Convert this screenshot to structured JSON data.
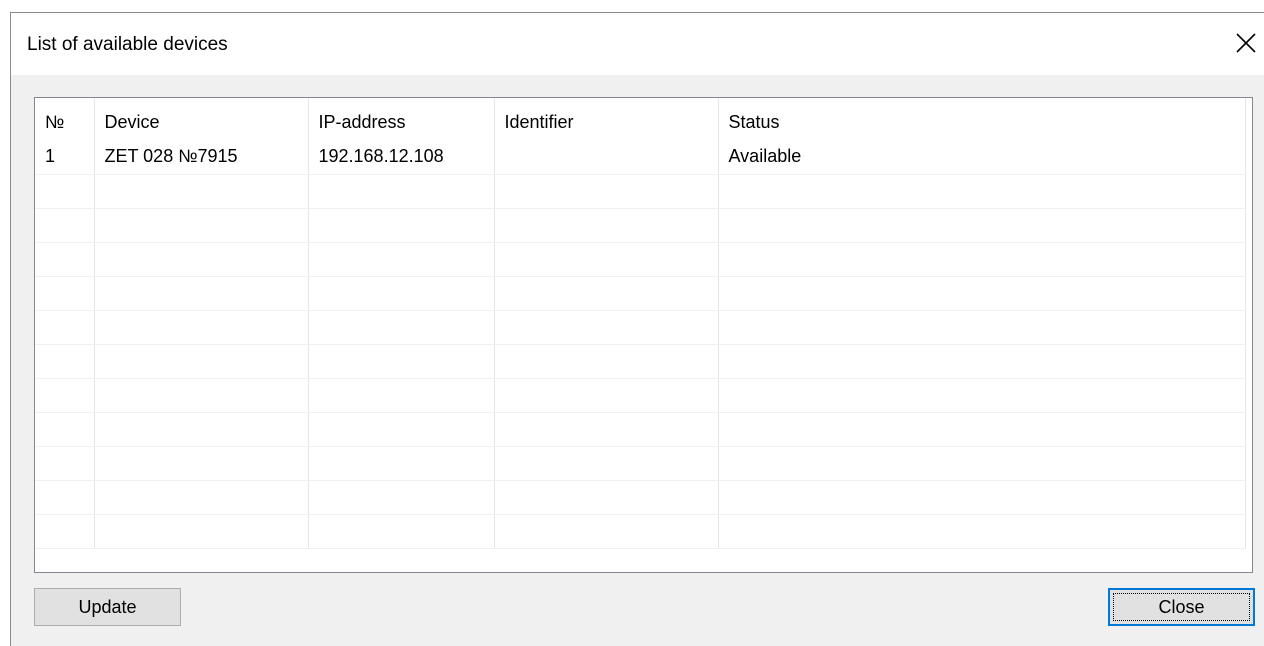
{
  "window": {
    "title": "List of available devices"
  },
  "table": {
    "columns": [
      "№",
      "Device",
      "IP-address",
      "Identifier",
      "Status"
    ],
    "rows": [
      [
        "1",
        "ZET 028 №7915",
        "192.168.12.108",
        "",
        "Available"
      ]
    ]
  },
  "buttons": {
    "update": "Update",
    "close": "Close"
  },
  "colors": {
    "window_bg": "#f0f0f0",
    "focus_accent": "#0078d7",
    "button_bg": "#e1e1e1"
  },
  "icons": {
    "close": "close-icon"
  }
}
